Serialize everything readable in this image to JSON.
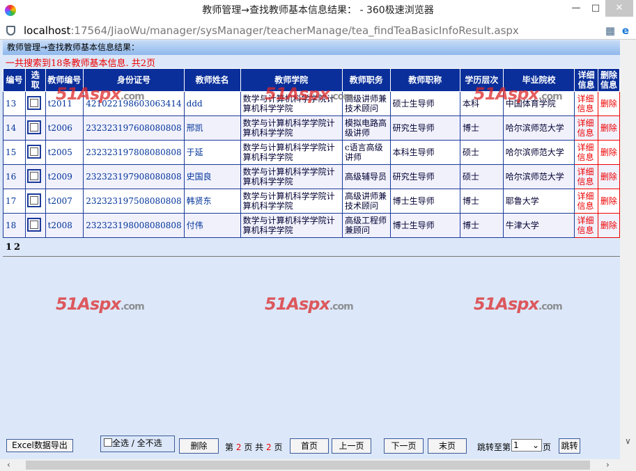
{
  "window": {
    "title": "教师管理→查找教师基本信息结果： - 360极速浏览器",
    "url_host": "localhost",
    "url_rest": ":17564/JiaoWu/manager/sysManager/teacherManage/tea_findTeaBasicInfoResult.aspx"
  },
  "page": {
    "header": "教师管理→查找教师基本信息结果：",
    "count_text": "一共搜索到18条教师基本信息. 共2页",
    "watermark": "51Aspx.com"
  },
  "table": {
    "columns": [
      "编号",
      "选取",
      "教师编号",
      "身份证号",
      "教师姓名",
      "教师学院",
      "教师职务",
      "教师职称",
      "学历层次",
      "毕业院校",
      "详细信息",
      "删除信息"
    ],
    "rows": [
      {
        "no": "13",
        "tid": "t2011",
        "idcard": "421022198603063414",
        "name": "ddd",
        "college": "数学与计算机科学学院计算机科学学院",
        "duty": "高级讲师兼技术顾问",
        "title": "硕士生导师",
        "edu": "本科",
        "school": "中国体育学院",
        "detail": "详细信息",
        "del": "删除"
      },
      {
        "no": "14",
        "tid": "t2006",
        "idcard": "232323197608080808",
        "name": "邢凯",
        "college": "数学与计算机科学学院计算机科学学院",
        "duty": "模拟电路高级讲师",
        "title": "研究生导师",
        "edu": "博士",
        "school": "哈尔滨师范大学",
        "detail": "详细信息",
        "del": "删除"
      },
      {
        "no": "15",
        "tid": "t2005",
        "idcard": "232323197808080808",
        "name": "于延",
        "college": "数学与计算机科学学院计算机科学学院",
        "duty": "c语言高级讲师",
        "title": "本科生导师",
        "edu": "硕士",
        "school": "哈尔滨师范大学",
        "detail": "详细信息",
        "del": "删除"
      },
      {
        "no": "16",
        "tid": "t2009",
        "idcard": "232323197908080808",
        "name": "史国良",
        "college": "数学与计算机科学学院计算机科学学院",
        "duty": "高级辅导员",
        "title": "研究生导师",
        "edu": "硕士",
        "school": "哈尔滨师范大学",
        "detail": "详细信息",
        "del": "删除"
      },
      {
        "no": "17",
        "tid": "t2007",
        "idcard": "232323197508080808",
        "name": "韩贤东",
        "college": "数学与计算机科学学院计算机科学学院",
        "duty": "高级讲师兼技术顾问",
        "title": "博士生导师",
        "edu": "博士",
        "school": "耶鲁大学",
        "detail": "详细信息",
        "del": "删除"
      },
      {
        "no": "18",
        "tid": "t2008",
        "idcard": "232323198008080808",
        "name": "付伟",
        "college": "数学与计算机科学学院计算机科学学院",
        "duty": "高级工程师兼顾问",
        "title": "博士生导师",
        "edu": "博士",
        "school": "牛津大学",
        "detail": "详细信息",
        "del": "删除"
      }
    ]
  },
  "pager": {
    "pages": [
      "1",
      "2"
    ]
  },
  "footer": {
    "excel": "Excel数据导出",
    "select_all": "全选 / 全不选",
    "delete": "删除",
    "page_prefix": "第",
    "current": "2",
    "page_mid": "页 共",
    "total": "2",
    "page_suffix": "页",
    "first": "首页",
    "prev": "上一页",
    "next": "下一页",
    "last": "末页",
    "jump_label": "跳转至第",
    "jump_value": "1",
    "jump_suffix": "页",
    "jump": "跳转"
  }
}
